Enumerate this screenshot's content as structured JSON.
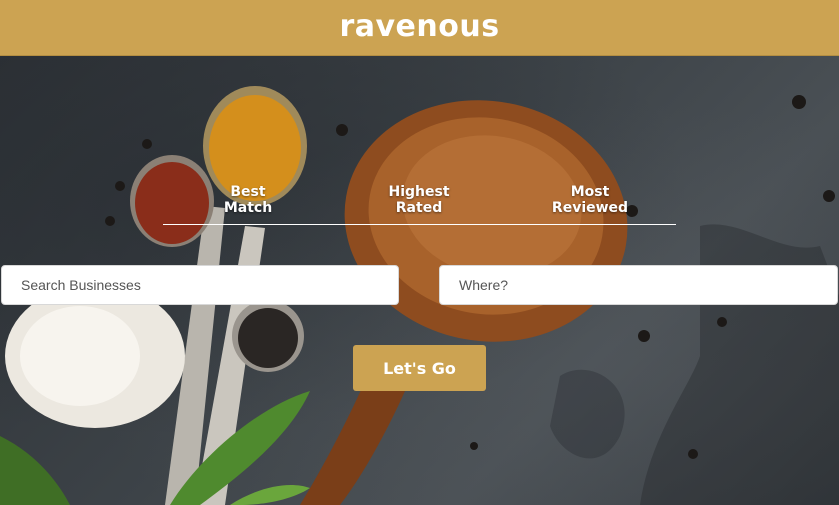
{
  "header": {
    "title": "ravenous"
  },
  "sort_options": [
    {
      "line1": "Best",
      "line2": "Match"
    },
    {
      "line1": "Highest",
      "line2": "Rated"
    },
    {
      "line1": "Most",
      "line2": "Reviewed"
    }
  ],
  "search": {
    "term_placeholder": "Search Businesses",
    "term_value": "",
    "location_placeholder": "Where?",
    "location_value": ""
  },
  "submit": {
    "label": "Let's Go"
  },
  "colors": {
    "brand": "#cca352",
    "text_on_brand": "#ffffff"
  },
  "background": {
    "icon": "food-spices-photo"
  }
}
